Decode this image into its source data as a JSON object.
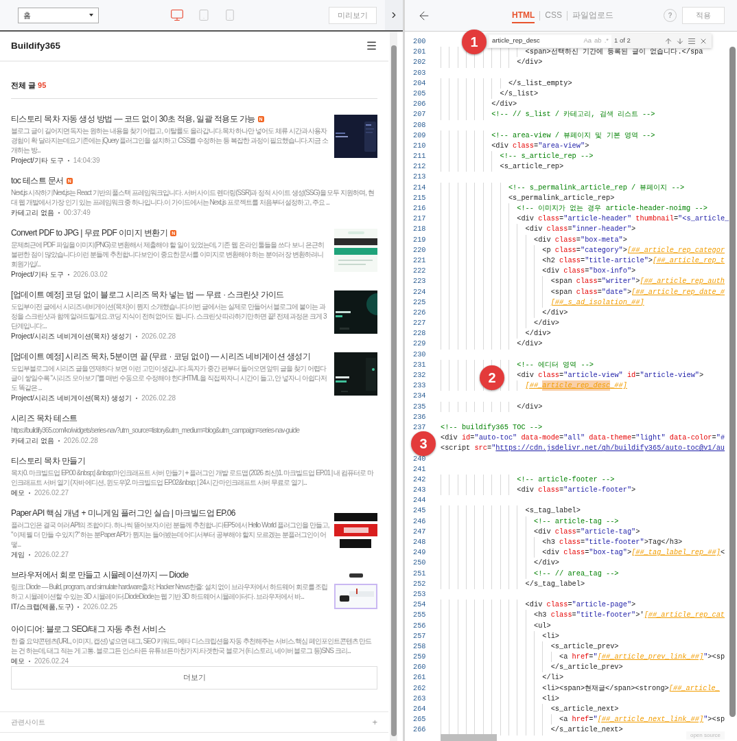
{
  "toolbar": {
    "page_select": {
      "value": "홈"
    },
    "devices": [
      {
        "kind": "desktop",
        "selected": true
      },
      {
        "kind": "tablet",
        "selected": false
      },
      {
        "kind": "mobile",
        "selected": false
      }
    ],
    "preview_button": "미리보기"
  },
  "preview": {
    "site_title": "Buildify365",
    "section_title": "전체 글",
    "post_count": "95",
    "posts": [
      {
        "title": "티스토리 목차 자동 생성 방법 — 코드 없이 30초 적용, 일괄 적용도 가능",
        "new_badge": "N",
        "excerpt": "블로그 글이 길어지면 독자는 원하는 내용을 찾기 어렵고, 이탈률도 올라갑니다.목차 하나만 넣어도 체류 시간과 사용자 경험이 확 달라지는데요.기존에는 jQuery 플러그인을 설치하고 CSS를 수정하는 등 복잡한 과정이 필요했습니다.지금 소개하는 방...",
        "category": "Project/기타 도구",
        "date": "14:04:39"
      },
      {
        "title": "toc 테스트 문서",
        "new_badge": "N",
        "excerpt": "Next.js 시작하기Next.js는 React 기반의 풀스택 프레임워크입니다. 서버 사이드 렌더링(SSR)과 정적 사이트 생성(SSG)을 모두 지원하며, 현대 웹 개발에서 가장 인기 있는 프레임워크 중 하나입니다.이 가이드에서는 Next.js 프로젝트를 처음부터 설정하고, 주요 ...",
        "category": "카테고리 없음",
        "date": "00:37:49"
      },
      {
        "title": "Convert PDF to JPG | 무료 PDF 이미지 변환기",
        "new_badge": "N",
        "excerpt": "문제최근에 PDF 파일을 이미지(PNG)로 변환해서 제출해야 할 일이 있었는데, 기존 웹 온라인 툴들을 쓰다 보니 은근히 불편한 점이 많았습니다.이런 분들께 추천합니다보안이 중요한 문서를 이미지로 변환해야 하는 분여러 장 변환하려니 회원가입/...",
        "category": "Project/기타 도구",
        "date": "2026.03.02"
      },
      {
        "title": "[업데이트 예정] 코딩 없이 블로그 시리즈 목차 넣는 법 — 무료 · 스크린샷 가이드",
        "excerpt": "도입부이전 글에서 시리즈 네비게이션(목차)이 뭔지 소개했습니다.이번 글에서는 실제로 만들어서 블로그에 붙이는 과정을 스크린샷과 함께 알려드릴게요.코딩 지식이 전혀 없어도 됩니다. 스크린샷 따라하기만 하면 끝! 전체 과정은 크게 3단계입니다:...",
        "category": "Project/시리즈 네비게이션(목차) 생성기",
        "date": "2026.02.28"
      },
      {
        "title": "[업데이트 예정] 시리즈 목차, 5분이면 끝 (무료 · 코딩 없이) — 시리즈 네비게이션 생성기",
        "excerpt": "도입부블로그에 시리즈 글을 연재하다 보면 이런 고민이 생깁니다.독자가 중간 편부터 들어오면 앞뒤 글을 찾기 어렵다글이 쌓일수록 \"시리즈 모아보기\"를 매번 수동으로 수정해야 한다HTML을 직접 짜자니 시간이 들고, 안 넣자니 아쉽다저도 똑같은 ...",
        "category": "Project/시리즈 네비게이션(목차) 생성기",
        "date": "2026.02.28"
      },
      {
        "title": "시리즈 목차 테스트",
        "excerpt": "https://buildify365.com/ko/widgets/series-nav?utm_source=tistory&utm_medium=blog&utm_campaign=series-nav-guide",
        "category": "카테고리 없음",
        "date": "2026.02.28"
      },
      {
        "title": "티스토리 목차 만들기",
        "excerpt": "목차0. 마크빌드업 EP.00 &nbsp;| &nbsp;마인크래프트 서버 만들기 + 플러그인 개발 로드맵 (2026 최신)1. 마크빌드업 EP.01 | 내 컴퓨터로 마인크래프트 서버 열기 (자바 에디션, 윈도우)2. 마크빌드업 EP.02&nbsp; | 24시간 마인크래프트 서버 무료로 열기...",
        "category": "메모",
        "date": "2026.02.27"
      },
      {
        "title": "Paper API 핵심 개념 + 미니게임 플러그인 실습 | 마크빌드업 EP.06",
        "excerpt": "플러그인은 결국 여러 API의 조합이다. 하나씩 뜯어보자.이런 분들께 추천합니다EP5에서 Hello World 플러그인을 만들고, \"이제 뭘 더 만들 수 있지?\" 하는 분Paper API가 뭔지는 들어봤는데 어디서부터 공부해야 할지 모르겠는 분플러그인이 어떻...",
        "category": "게임",
        "date": "2026.02.27"
      },
      {
        "title": "브라우저에서 회로 만들고 시뮬레이션까지 — Diode",
        "excerpt": "링크: Diode — Build, program, and simulate hardware출처: Hacker News한줄: 설치 없이 브라우저에서 하드웨어 회로를 조립하고 시뮬레이션할 수 있는 3D 시뮬레이터.DiodeDiode는 웹 기반 3D 하드웨어 시뮬레이터다. 브라우저에서 바...",
        "category": "IT/스크랩(제품,도구)",
        "date": "2026.02.25"
      },
      {
        "title": "아이디어: 블로그 SEO/태그 자동 추천 서비스",
        "excerpt": "한 줄 요약콘텐츠(URL, 이미지, 캡션) 넣으면 태그, SEO 키워드, 메타 디스크립션을 자동 추천해주는 서비스.핵심 페인포인트콘텐츠 만드는 건 하는데, 태그 적는 게 고통. 블로그든 인스타든 유튜브든 마찬가지.타겟한국 블로거 (티스토리, 네이버 블로그 등)SNS 크리...",
        "category": "메모",
        "date": "2026.02.24"
      }
    ],
    "more_button": "더보기",
    "footer": {
      "label": "관련사이트",
      "toggle": "+"
    }
  },
  "code_panel": {
    "tabs": [
      {
        "label": "HTML",
        "selected": true
      },
      {
        "label": "CSS",
        "selected": false
      },
      {
        "label": "파일업로드",
        "selected": false
      }
    ],
    "help": "?",
    "apply_button": "적용",
    "find": {
      "value": "article_rep_desc",
      "options": [
        {
          "label": "Aa",
          "selected": false
        },
        {
          "label": "ab",
          "selected": false
        },
        {
          "label": ".*",
          "selected": false
        }
      ],
      "count": "1 of 2"
    },
    "lines": [
      {
        "number": "200"
      },
      {
        "number": "201",
        "tokens": [
          {
            "kind": "plain",
            "text": "                    <span>선택하신 기간에 등록된 글이 없습니다.</spa"
          }
        ]
      },
      {
        "number": "202",
        "tokens": [
          {
            "kind": "plain",
            "text": "                  </div>"
          }
        ]
      },
      {
        "number": "203"
      },
      {
        "number": "204",
        "tokens": [
          {
            "kind": "plain",
            "text": "                </s_list_empty>"
          }
        ]
      },
      {
        "number": "205",
        "tokens": [
          {
            "kind": "plain",
            "text": "              </s_list>"
          }
        ]
      },
      {
        "number": "206",
        "tokens": [
          {
            "kind": "plain",
            "text": "            </div>"
          }
        ]
      },
      {
        "number": "207",
        "tokens": [
          {
            "kind": "comment",
            "text": "            <!-- // s_list / 카테고리, 검색 리스트 -->"
          }
        ]
      },
      {
        "number": "208"
      },
      {
        "number": "209",
        "tokens": [
          {
            "kind": "comment",
            "text": "            <!-- area-view / 뷰페이지 및 기본 영역 -->"
          }
        ]
      },
      {
        "number": "210",
        "tokens": [
          {
            "kind": "plain",
            "text": "            <div "
          },
          {
            "kind": "attr",
            "text": "class"
          },
          {
            "kind": "plain",
            "text": "="
          },
          {
            "kind": "string",
            "text": "\"area-view\""
          },
          {
            "kind": "plain",
            "text": ">"
          }
        ]
      },
      {
        "number": "211",
        "tokens": [
          {
            "kind": "comment",
            "text": "              <!-- s_article_rep -->"
          }
        ]
      },
      {
        "number": "212",
        "tokens": [
          {
            "kind": "plain",
            "text": "              <s_article_rep>"
          }
        ]
      },
      {
        "number": "213"
      },
      {
        "number": "214",
        "tokens": [
          {
            "kind": "comment",
            "text": "                <!-- s_permalink_article_rep / 뷰페이지 -->"
          }
        ]
      },
      {
        "number": "215",
        "tokens": [
          {
            "kind": "plain",
            "text": "                <s_permalink_article_rep>"
          }
        ]
      },
      {
        "number": "216",
        "tokens": [
          {
            "kind": "comment",
            "text": "                  <!-- 이미지가 없는 경우 article-header-noimg -->"
          }
        ]
      },
      {
        "number": "217",
        "tokens": [
          {
            "kind": "plain",
            "text": "                  <div "
          },
          {
            "kind": "attr",
            "text": "class"
          },
          {
            "kind": "plain",
            "text": "="
          },
          {
            "kind": "string",
            "text": "\"article-header\""
          },
          {
            "kind": "attr",
            "text": " thumbnail"
          },
          {
            "kind": "plain",
            "text": "="
          },
          {
            "kind": "string",
            "text": "\"<s_article_"
          }
        ]
      },
      {
        "number": "218",
        "tokens": [
          {
            "kind": "plain",
            "text": "                    <div "
          },
          {
            "kind": "attr",
            "text": "class"
          },
          {
            "kind": "plain",
            "text": "="
          },
          {
            "kind": "string",
            "text": "\"inner-header\""
          },
          {
            "kind": "plain",
            "text": ">"
          }
        ]
      },
      {
        "number": "219",
        "tokens": [
          {
            "kind": "plain",
            "text": "                      <div "
          },
          {
            "kind": "attr",
            "text": "class"
          },
          {
            "kind": "plain",
            "text": "="
          },
          {
            "kind": "string",
            "text": "\"box-meta\""
          },
          {
            "kind": "plain",
            "text": ">"
          }
        ]
      },
      {
        "number": "220",
        "tokens": [
          {
            "kind": "plain",
            "text": "                        <p "
          },
          {
            "kind": "attr",
            "text": "class"
          },
          {
            "kind": "plain",
            "text": "="
          },
          {
            "kind": "string",
            "text": "\"category\""
          },
          {
            "kind": "plain",
            "text": ">"
          },
          {
            "kind": "var",
            "text": "[##_article_rep_categor"
          }
        ]
      },
      {
        "number": "221",
        "tokens": [
          {
            "kind": "plain",
            "text": "                        <h2 "
          },
          {
            "kind": "attr",
            "text": "class"
          },
          {
            "kind": "plain",
            "text": "="
          },
          {
            "kind": "string",
            "text": "\"title-article\""
          },
          {
            "kind": "plain",
            "text": ">"
          },
          {
            "kind": "var",
            "text": "[##_article_rep_t"
          }
        ]
      },
      {
        "number": "222",
        "tokens": [
          {
            "kind": "plain",
            "text": "                        <div "
          },
          {
            "kind": "attr",
            "text": "class"
          },
          {
            "kind": "plain",
            "text": "="
          },
          {
            "kind": "string",
            "text": "\"box-info\""
          },
          {
            "kind": "plain",
            "text": ">"
          }
        ]
      },
      {
        "number": "223",
        "tokens": [
          {
            "kind": "plain",
            "text": "                          <span "
          },
          {
            "kind": "attr",
            "text": "class"
          },
          {
            "kind": "plain",
            "text": "="
          },
          {
            "kind": "string",
            "text": "\"writer\""
          },
          {
            "kind": "plain",
            "text": ">"
          },
          {
            "kind": "var",
            "text": "[##_article_rep_auth"
          }
        ]
      },
      {
        "number": "224",
        "tokens": [
          {
            "kind": "plain",
            "text": "                          <span "
          },
          {
            "kind": "attr",
            "text": "class"
          },
          {
            "kind": "plain",
            "text": "="
          },
          {
            "kind": "string",
            "text": "\"date\""
          },
          {
            "kind": "plain",
            "text": ">"
          },
          {
            "kind": "var",
            "text": "[##_article_rep_date_#"
          }
        ]
      },
      {
        "number": "225",
        "tokens": [
          {
            "kind": "var",
            "text": "                          [##_s_ad_isolation_##]"
          }
        ]
      },
      {
        "number": "226",
        "tokens": [
          {
            "kind": "plain",
            "text": "                        </div>"
          }
        ]
      },
      {
        "number": "227",
        "tokens": [
          {
            "kind": "plain",
            "text": "                      </div>"
          }
        ]
      },
      {
        "number": "228",
        "tokens": [
          {
            "kind": "plain",
            "text": "                    </div>"
          }
        ]
      },
      {
        "number": "229",
        "tokens": [
          {
            "kind": "plain",
            "text": "                  </div>"
          }
        ]
      },
      {
        "number": "230"
      },
      {
        "number": "231",
        "tokens": [
          {
            "kind": "comment",
            "text": "                  <!-- 에디터 영역 -->"
          }
        ]
      },
      {
        "number": "232",
        "tokens": [
          {
            "kind": "plain",
            "text": "                  <div "
          },
          {
            "kind": "attr",
            "text": "class"
          },
          {
            "kind": "plain",
            "text": "="
          },
          {
            "kind": "string",
            "text": "\"article-view\""
          },
          {
            "kind": "attr",
            "text": " id"
          },
          {
            "kind": "plain",
            "text": "="
          },
          {
            "kind": "string",
            "text": "\"article-view\""
          },
          {
            "kind": "plain",
            "text": ">"
          }
        ]
      },
      {
        "number": "233",
        "tokens": [
          {
            "kind": "var",
            "text": "                    [##_"
          },
          {
            "kind": "match",
            "text": "article_rep_desc"
          },
          {
            "kind": "var",
            "text": "_##]"
          }
        ]
      },
      {
        "number": "234"
      },
      {
        "number": "235",
        "tokens": [
          {
            "kind": "plain",
            "text": "                  </div>"
          }
        ]
      },
      {
        "number": "236"
      },
      {
        "number": "237",
        "tokens": [
          {
            "kind": "comment",
            "text": "<!-- buildify365 TOC -->"
          }
        ]
      },
      {
        "tokens": [
          {
            "kind": "plain",
            "text": "<div "
          },
          {
            "kind": "attr",
            "text": "id"
          },
          {
            "kind": "plain",
            "text": "="
          },
          {
            "kind": "string",
            "text": "\"auto-toc\""
          },
          {
            "kind": "attr",
            "text": " data-mode"
          },
          {
            "kind": "plain",
            "text": "="
          },
          {
            "kind": "string",
            "text": "\"all\""
          },
          {
            "kind": "attr",
            "text": " data-theme"
          },
          {
            "kind": "plain",
            "text": "="
          },
          {
            "kind": "string",
            "text": "\"light\""
          },
          {
            "kind": "attr",
            "text": " data-color"
          },
          {
            "kind": "plain",
            "text": "="
          },
          {
            "kind": "string",
            "text": "\"#"
          }
        ]
      },
      {
        "tokens": [
          {
            "kind": "plain",
            "text": "<script "
          },
          {
            "kind": "attr",
            "text": "src"
          },
          {
            "kind": "plain",
            "text": "="
          },
          {
            "kind": "string",
            "text": "\""
          },
          {
            "kind": "url",
            "text": "https://cdn.jsdelivr.net/gh/buildify365/auto-toc@v1/au"
          }
        ]
      },
      {
        "number": "240"
      },
      {
        "number": "241"
      },
      {
        "number": "242",
        "tokens": [
          {
            "kind": "comment",
            "text": "                  <!-- article-footer -->"
          }
        ]
      },
      {
        "number": "243",
        "tokens": [
          {
            "kind": "plain",
            "text": "                  <div "
          },
          {
            "kind": "attr",
            "text": "class"
          },
          {
            "kind": "plain",
            "text": "="
          },
          {
            "kind": "string",
            "text": "\"article-footer\""
          },
          {
            "kind": "plain",
            "text": ">"
          }
        ]
      },
      {
        "number": "244"
      },
      {
        "number": "245",
        "tokens": [
          {
            "kind": "plain",
            "text": "                    <s_tag_label>"
          }
        ]
      },
      {
        "number": "246",
        "tokens": [
          {
            "kind": "comment",
            "text": "                      <!-- article-tag -->"
          }
        ]
      },
      {
        "number": "247",
        "tokens": [
          {
            "kind": "plain",
            "text": "                      <div "
          },
          {
            "kind": "attr",
            "text": "class"
          },
          {
            "kind": "plain",
            "text": "="
          },
          {
            "kind": "string",
            "text": "\"article-tag\""
          },
          {
            "kind": "plain",
            "text": ">"
          }
        ]
      },
      {
        "number": "248",
        "tokens": [
          {
            "kind": "plain",
            "text": "                        <h3 "
          },
          {
            "kind": "attr",
            "text": "class"
          },
          {
            "kind": "plain",
            "text": "="
          },
          {
            "kind": "string",
            "text": "\"title-footer\""
          },
          {
            "kind": "plain",
            "text": ">Tag</h3>"
          }
        ]
      },
      {
        "number": "249",
        "tokens": [
          {
            "kind": "plain",
            "text": "                        <div "
          },
          {
            "kind": "attr",
            "text": "class"
          },
          {
            "kind": "plain",
            "text": "="
          },
          {
            "kind": "string",
            "text": "\"box-tag\""
          },
          {
            "kind": "plain",
            "text": ">"
          },
          {
            "kind": "var",
            "text": "[##_tag_label_rep_##]"
          },
          {
            "kind": "plain",
            "text": "<"
          }
        ]
      },
      {
        "number": "250",
        "tokens": [
          {
            "kind": "plain",
            "text": "                      </div>"
          }
        ]
      },
      {
        "number": "251",
        "tokens": [
          {
            "kind": "comment",
            "text": "                      <!-- // area_tag -->"
          }
        ]
      },
      {
        "number": "252",
        "tokens": [
          {
            "kind": "plain",
            "text": "                    </s_tag_label>"
          }
        ]
      },
      {
        "number": "253"
      },
      {
        "number": "254",
        "tokens": [
          {
            "kind": "plain",
            "text": "                    <div "
          },
          {
            "kind": "attr",
            "text": "class"
          },
          {
            "kind": "plain",
            "text": "="
          },
          {
            "kind": "string",
            "text": "\"article-page\""
          },
          {
            "kind": "plain",
            "text": ">"
          }
        ]
      },
      {
        "number": "255",
        "tokens": [
          {
            "kind": "plain",
            "text": "                      <h3 "
          },
          {
            "kind": "attr",
            "text": "class"
          },
          {
            "kind": "plain",
            "text": "="
          },
          {
            "kind": "string",
            "text": "\"title-footer\""
          },
          {
            "kind": "plain",
            "text": ">'"
          },
          {
            "kind": "var",
            "text": "[##_article_rep_cat"
          }
        ]
      },
      {
        "number": "256",
        "tokens": [
          {
            "kind": "plain",
            "text": "                      <ul>"
          }
        ]
      },
      {
        "number": "257",
        "tokens": [
          {
            "kind": "plain",
            "text": "                        <li>"
          }
        ]
      },
      {
        "number": "258",
        "tokens": [
          {
            "kind": "plain",
            "text": "                          <s_article_prev>"
          }
        ]
      },
      {
        "number": "259",
        "tokens": [
          {
            "kind": "plain",
            "text": "                            <a "
          },
          {
            "kind": "attr",
            "text": "href"
          },
          {
            "kind": "plain",
            "text": "="
          },
          {
            "kind": "string",
            "text": "\""
          },
          {
            "kind": "var",
            "text": "[##_article_prev_link_##]"
          },
          {
            "kind": "string",
            "text": "\""
          },
          {
            "kind": "plain",
            "text": "><sp"
          }
        ]
      },
      {
        "number": "260",
        "tokens": [
          {
            "kind": "plain",
            "text": "                          </s_article_prev>"
          }
        ]
      },
      {
        "number": "261",
        "tokens": [
          {
            "kind": "plain",
            "text": "                        </li>"
          }
        ]
      },
      {
        "number": "262",
        "tokens": [
          {
            "kind": "plain",
            "text": "                        <li><span>현재글</span><strong>"
          },
          {
            "kind": "var",
            "text": "[##_article_"
          }
        ]
      },
      {
        "number": "263",
        "tokens": [
          {
            "kind": "plain",
            "text": "                        <li>"
          }
        ]
      },
      {
        "number": "264",
        "tokens": [
          {
            "kind": "plain",
            "text": "                          <s_article_next>"
          }
        ]
      },
      {
        "number": "265",
        "tokens": [
          {
            "kind": "plain",
            "text": "                            <a "
          },
          {
            "kind": "attr",
            "text": "href"
          },
          {
            "kind": "plain",
            "text": "="
          },
          {
            "kind": "string",
            "text": "\""
          },
          {
            "kind": "var",
            "text": "[##_article_next_link_##]"
          },
          {
            "kind": "string",
            "text": "\""
          },
          {
            "kind": "plain",
            "text": "><sp"
          }
        ]
      },
      {
        "number": "266",
        "tokens": [
          {
            "kind": "plain",
            "text": "                          </s_article_next>"
          }
        ]
      }
    ],
    "footer_label": "open source"
  },
  "callouts": [
    "1",
    "2",
    "3"
  ]
}
